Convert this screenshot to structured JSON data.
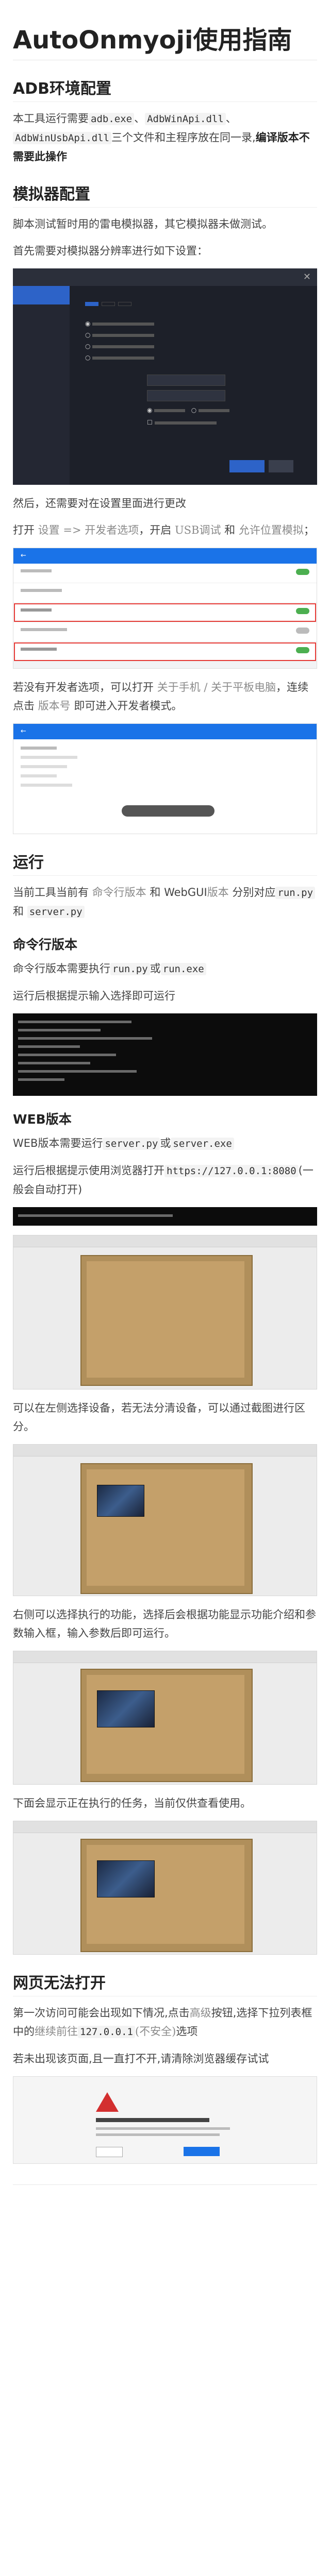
{
  "title": "AutoOnmyoji使用指南",
  "adb": {
    "heading": "ADB环境配置",
    "p1_a": "本工具运行需要",
    "p1_code1": "adb.exe",
    "p1_b": "、",
    "p1_code2": "AdbWinApi.dll",
    "p1_c": "、",
    "p1_code3": "AdbWinUsbApi.dll",
    "p1_d": "三个文件和主程序放在同一录,",
    "p1_bold": "编译版本不需要此操作"
  },
  "emu": {
    "heading": "模拟器配置",
    "p1": "脚本测试暂时用的雷电模拟器，其它模拟器未做测试。",
    "p2": "首先需要对模拟器分辨率进行如下设置：",
    "p3": "然后，还需要对在设置里面进行更改",
    "p4_a": "打开",
    "p4_s1": "设置",
    "p4_b": "=>",
    "p4_s2": "开发者选项",
    "p4_c": "，开启",
    "p4_s3": "USB调试",
    "p4_d": "和",
    "p4_s4": "允许位置模拟",
    "p4_e": "；",
    "p5_a": "若没有开发者选项，可以打开",
    "p5_s1": "关于手机",
    "p5_b": "/",
    "p5_s2": "关于平板电脑",
    "p5_c": "，连续点击",
    "p5_s3": "版本号",
    "p5_d": "即可进入开发者模式。"
  },
  "run": {
    "heading": "运行",
    "p1_a": "当前工具当前有",
    "p1_s1": "命令行版本",
    "p1_b": "和",
    "p1_c": "WebGUI",
    "p1_s2": "版本",
    "p1_d": "分别对应",
    "p1_code1": "run.py",
    "p1_e": "和",
    "p1_code2": "server.py",
    "cli_heading": "命令行版本",
    "cli_p1_a": "命令行版本需要执行",
    "cli_p1_code1": "run.py",
    "cli_p1_b": "或",
    "cli_p1_code2": "run.exe",
    "cli_p2": "运行后根据提示输入选择即可运行",
    "web_heading": "WEB版本",
    "web_p1_a": "WEB版本需要运行",
    "web_p1_code1": "server.py",
    "web_p1_b": "或",
    "web_p1_code2": "server.exe",
    "web_p2_a": "运行后根据提示使用浏览器打开",
    "web_p2_code": "https://127.0.0.1:8080",
    "web_p2_b": "(一般会自动打开)",
    "web_p3": "可以在左侧选择设备，若无法分清设备，可以通过截图进行区分。",
    "web_p4": "右侧可以选择执行的功能，选择后会根据功能显示功能介绍和参数输入框，输入参数后即可运行。",
    "web_p5": "下面会显示正在执行的任务，当前仅供查看使用。"
  },
  "web_fail": {
    "heading": "网页无法打开",
    "p1_a": "第一次访问可能会出现如下情况,点击",
    "p1_s1": "高级",
    "p1_b": "按钮,选择下拉列表框中的",
    "p1_s2": "继续前往",
    "p1_code": "127.0.0.1",
    "p1_s3": "(不安全)",
    "p1_c": "选项",
    "p2": "若未出现该页面,且一直打不开,请清除浏览器缓存试试"
  }
}
